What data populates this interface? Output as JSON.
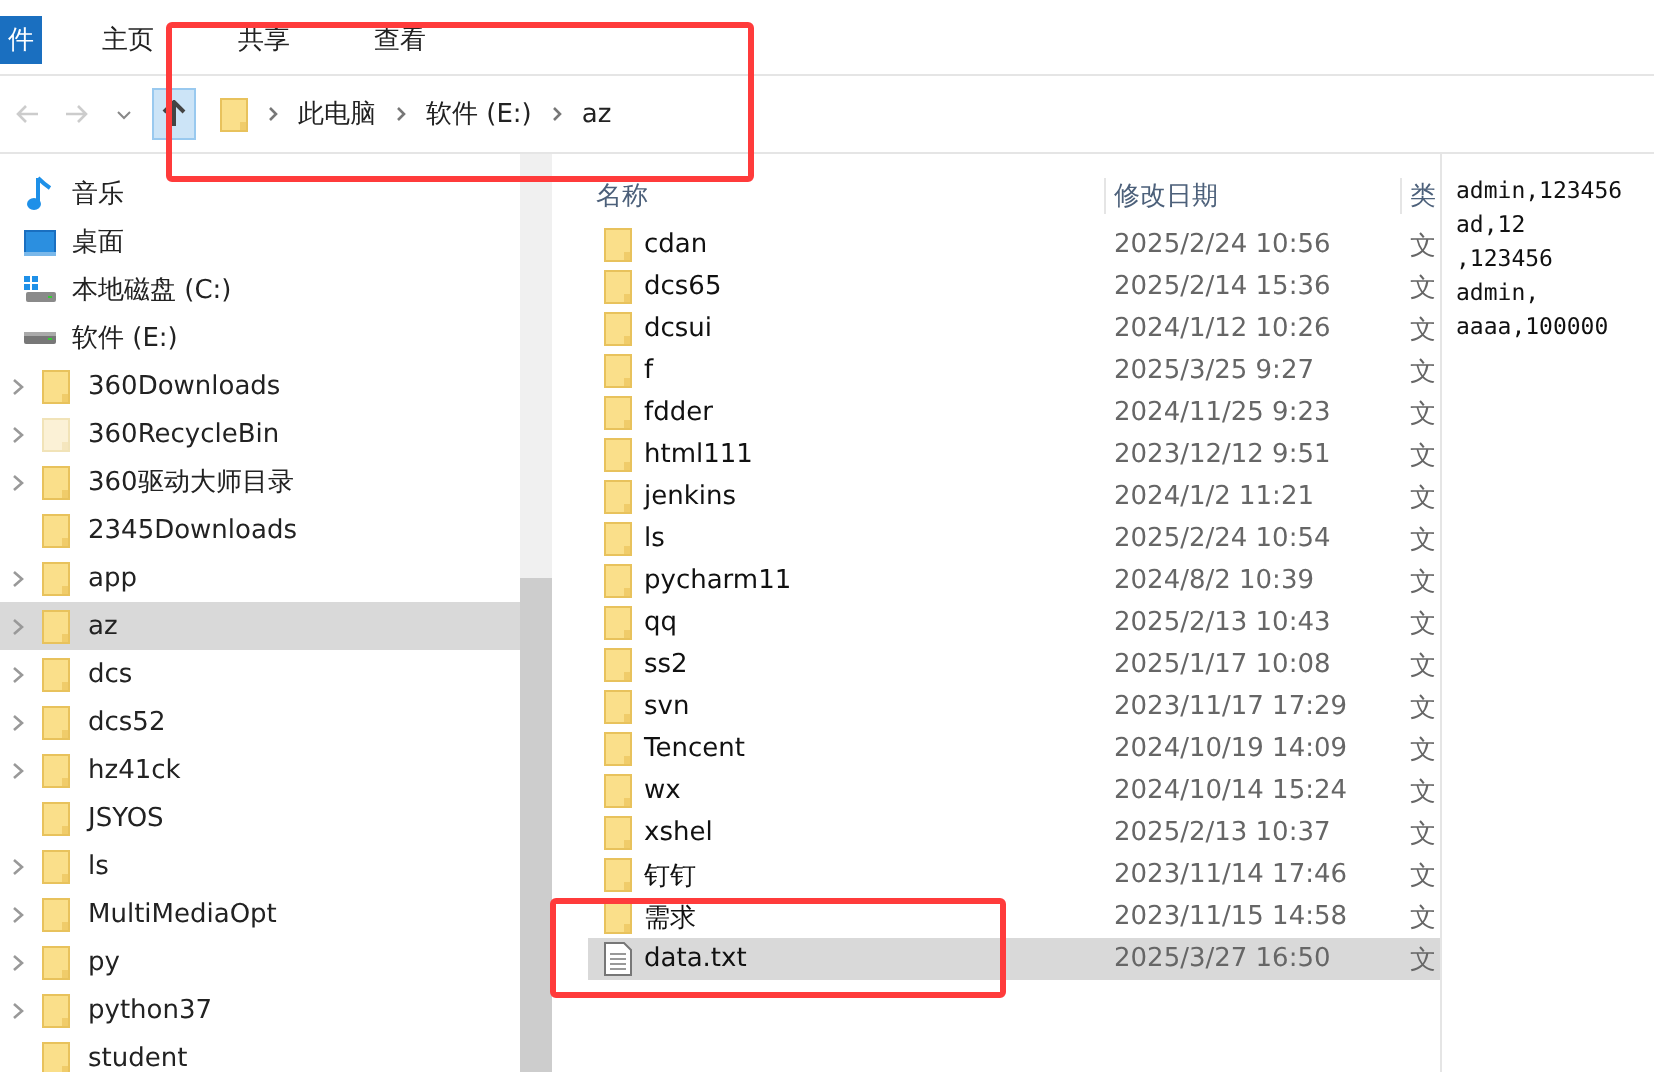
{
  "ribbon_tabs": [
    {
      "label": "件",
      "selected": true
    },
    {
      "label": "主页",
      "selected": false
    },
    {
      "label": "共享",
      "selected": false
    },
    {
      "label": "查看",
      "selected": false
    }
  ],
  "address": [
    "此电脑",
    "软件 (E:)",
    "az"
  ],
  "sidebar": {
    "items": [
      {
        "label": "音乐",
        "kind": "music",
        "selected": false
      },
      {
        "label": "桌面",
        "kind": "desktop",
        "selected": false
      },
      {
        "label": "本地磁盘 (C:)",
        "kind": "system-drive",
        "selected": false
      },
      {
        "label": "软件 (E:)",
        "kind": "drive",
        "selected": false
      },
      {
        "label": "360Downloads",
        "kind": "folder",
        "expandable": true,
        "hidden": false,
        "selected": false
      },
      {
        "label": "360RecycleBin",
        "kind": "folder",
        "expandable": true,
        "hidden": true,
        "selected": false
      },
      {
        "label": "360驱动大师目录",
        "kind": "folder",
        "expandable": true,
        "hidden": false,
        "selected": false
      },
      {
        "label": "2345Downloads",
        "kind": "folder",
        "expandable": false,
        "hidden": false,
        "selected": false
      },
      {
        "label": "app",
        "kind": "folder",
        "expandable": true,
        "hidden": false,
        "selected": false
      },
      {
        "label": "az",
        "kind": "folder",
        "expandable": true,
        "hidden": false,
        "selected": true
      },
      {
        "label": "dcs",
        "kind": "folder",
        "expandable": true,
        "hidden": false,
        "selected": false
      },
      {
        "label": "dcs52",
        "kind": "folder",
        "expandable": true,
        "hidden": false,
        "selected": false
      },
      {
        "label": "hz41ck",
        "kind": "folder",
        "expandable": true,
        "hidden": false,
        "selected": false
      },
      {
        "label": "JSYOS",
        "kind": "folder",
        "expandable": false,
        "hidden": false,
        "selected": false
      },
      {
        "label": "ls",
        "kind": "folder",
        "expandable": true,
        "hidden": false,
        "selected": false
      },
      {
        "label": "MultiMediaOpt",
        "kind": "folder",
        "expandable": true,
        "hidden": false,
        "selected": false
      },
      {
        "label": "py",
        "kind": "folder",
        "expandable": true,
        "hidden": false,
        "selected": false
      },
      {
        "label": "python37",
        "kind": "folder",
        "expandable": true,
        "hidden": false,
        "selected": false
      },
      {
        "label": "student",
        "kind": "folder",
        "expandable": false,
        "hidden": false,
        "selected": false
      }
    ]
  },
  "table": {
    "columns": [
      "名称",
      "修改日期",
      "类"
    ],
    "rows": [
      {
        "name": "cdan",
        "date": "2025/2/24 10:56",
        "type": "文",
        "kind": "folder",
        "selected": false
      },
      {
        "name": "dcs65",
        "date": "2025/2/14 15:36",
        "type": "文",
        "kind": "folder",
        "selected": false
      },
      {
        "name": "dcsui",
        "date": "2024/1/12 10:26",
        "type": "文",
        "kind": "folder",
        "selected": false
      },
      {
        "name": "f",
        "date": "2025/3/25 9:27",
        "type": "文",
        "kind": "folder",
        "selected": false
      },
      {
        "name": "fdder",
        "date": "2024/11/25 9:23",
        "type": "文",
        "kind": "folder",
        "selected": false
      },
      {
        "name": "html111",
        "date": "2023/12/12 9:51",
        "type": "文",
        "kind": "folder",
        "selected": false
      },
      {
        "name": "jenkins",
        "date": "2024/1/2 11:21",
        "type": "文",
        "kind": "folder",
        "selected": false
      },
      {
        "name": "ls",
        "date": "2025/2/24 10:54",
        "type": "文",
        "kind": "folder",
        "selected": false
      },
      {
        "name": "pycharm11",
        "date": "2024/8/2 10:39",
        "type": "文",
        "kind": "folder",
        "selected": false
      },
      {
        "name": "qq",
        "date": "2025/2/13 10:43",
        "type": "文",
        "kind": "folder",
        "selected": false
      },
      {
        "name": "ss2",
        "date": "2025/1/17 10:08",
        "type": "文",
        "kind": "folder",
        "selected": false
      },
      {
        "name": "svn",
        "date": "2023/11/17 17:29",
        "type": "文",
        "kind": "folder",
        "selected": false
      },
      {
        "name": "Tencent",
        "date": "2024/10/19 14:09",
        "type": "文",
        "kind": "folder",
        "selected": false
      },
      {
        "name": "wx",
        "date": "2024/10/14 15:24",
        "type": "文",
        "kind": "folder",
        "selected": false
      },
      {
        "name": "xshel",
        "date": "2025/2/13 10:37",
        "type": "文",
        "kind": "folder",
        "selected": false
      },
      {
        "name": "钉钉",
        "date": "2023/11/14 17:46",
        "type": "文",
        "kind": "folder",
        "selected": false
      },
      {
        "name": "需求",
        "date": "2023/11/15 14:58",
        "type": "文",
        "kind": "folder",
        "selected": false
      },
      {
        "name": "data.txt",
        "date": "2025/3/27 16:50",
        "type": "文",
        "kind": "text-file",
        "selected": true
      }
    ]
  },
  "preview_lines": [
    "admin,123456",
    "ad,12",
    ",123456",
    "admin,",
    "aaaa,100000"
  ]
}
